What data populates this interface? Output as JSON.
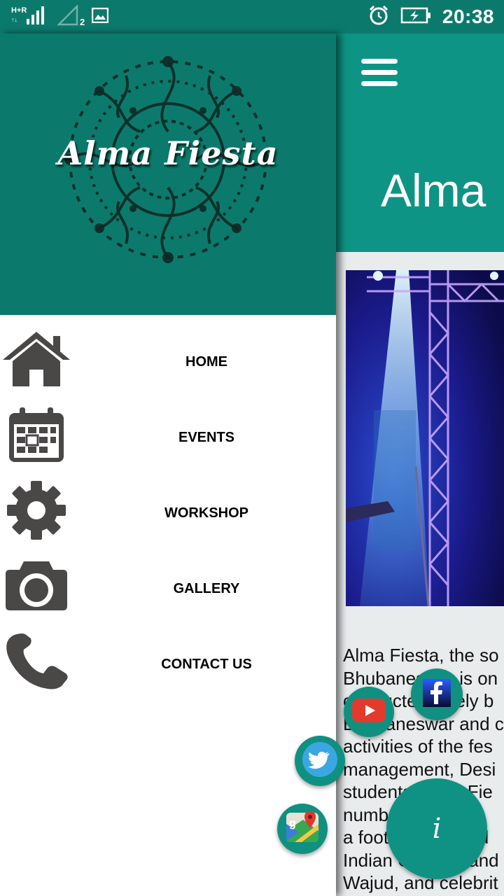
{
  "status_bar": {
    "network_type": "H+",
    "sim_slot": "2",
    "time": "20:38",
    "icons": [
      "signal-icon",
      "signal-empty-icon",
      "image-icon",
      "alarm-icon",
      "battery-charging-icon"
    ]
  },
  "main": {
    "title": "Alma",
    "about_lines": [
      " Alma Fiesta, the so",
      "Bhubaneswar is on",
      "conducted solely b",
      "Bhubaneswar and c",
      "activities of the fes",
      "management, Desi",
      "students. Alma Fie",
      "number of events",
      "a foot tapping and",
      "Indian Ocean Band",
      "Wajud, and celebrit"
    ]
  },
  "drawer": {
    "logo_text": "Alma Fiesta",
    "menu": [
      {
        "label": "HOME",
        "icon": "home-icon"
      },
      {
        "label": "EVENTS",
        "icon": "calendar-icon"
      },
      {
        "label": "WORKSHOP",
        "icon": "gear-icon"
      },
      {
        "label": "GALLERY",
        "icon": "camera-icon"
      },
      {
        "label": "CONTACT US",
        "icon": "phone-icon"
      }
    ]
  },
  "fabs": {
    "info_label": "i",
    "icons": [
      "youtube-icon",
      "facebook-icon",
      "twitter-icon",
      "maps-icon",
      "info-icon"
    ]
  },
  "colors": {
    "drawer_header": "#0b7a6c",
    "app_header": "#0d9484",
    "fab": "#109080",
    "menu_icon": "#4a4747"
  }
}
